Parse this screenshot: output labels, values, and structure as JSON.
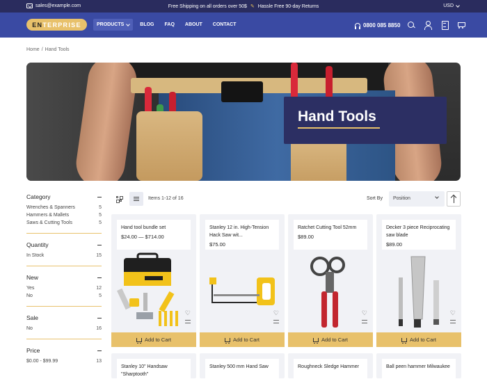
{
  "topbar": {
    "email": "sales@example.com",
    "promo_left": "Free Shipping on all orders over 50$",
    "promo_right": "Hassle Free 90-day Returns",
    "currency": "USD"
  },
  "header": {
    "logo_first": "E",
    "logo_second": "N",
    "logo_rest": "TERPRISE",
    "menu": [
      "PRODUCTS",
      "BLOG",
      "FAQ",
      "ABOUT",
      "CONTACT"
    ],
    "phone": "0800 085 8850"
  },
  "breadcrumb": {
    "home": "Home",
    "separator": "/",
    "current": "Hand Tools"
  },
  "hero": {
    "title": "Hand Tools"
  },
  "sidebar": {
    "facets": [
      {
        "title": "Category",
        "items": [
          {
            "label": "Wrenches & Spanners",
            "count": "5"
          },
          {
            "label": "Hammers & Mallets",
            "count": "5"
          },
          {
            "label": "Saws & Cutting Tools",
            "count": "5"
          }
        ]
      },
      {
        "title": "Quantity",
        "items": [
          {
            "label": "In Stock",
            "count": "15"
          }
        ]
      },
      {
        "title": "New",
        "items": [
          {
            "label": "Yes",
            "count": "12"
          },
          {
            "label": "No",
            "count": "5"
          }
        ]
      },
      {
        "title": "Sale",
        "items": [
          {
            "label": "No",
            "count": "16"
          }
        ]
      },
      {
        "title": "Price",
        "items": [
          {
            "label": "$0.00 - $99.99",
            "count": "13"
          }
        ]
      }
    ]
  },
  "toolbar": {
    "items_count": "Items 1-12 of 16",
    "sort_label": "Sort By",
    "sort_value": "Position"
  },
  "products": [
    {
      "name": "Hand tool bundle set",
      "price": "$24.00 — $714.00",
      "button": "Add to Cart"
    },
    {
      "name": "Stanley 12 in. High-Tension Hack Saw wit...",
      "price": "$75.00",
      "button": "Add to Cart"
    },
    {
      "name": "Ratchet Cutting Tool 52mm",
      "price": "$89.00",
      "button": "Add to Cart"
    },
    {
      "name": "Decker 3 piece Reciprocating saw blade",
      "price": "$89.00",
      "button": "Add to Cart"
    },
    {
      "name": "Stanley 10\" Handsaw \"Sharptooth\"",
      "price": "",
      "button": ""
    },
    {
      "name": "Stanley 500 mm Hand Saw",
      "price": "",
      "button": ""
    },
    {
      "name": "Roughneck Sledge Hammer",
      "price": "",
      "button": ""
    },
    {
      "name": "Ball peen hammer Milwaukee",
      "price": "",
      "button": ""
    }
  ],
  "colors": {
    "topbar": "#2a2c5e",
    "nav": "#3a4aa3",
    "accent": "#e8c16b",
    "hero_box": "#2c2f63"
  }
}
